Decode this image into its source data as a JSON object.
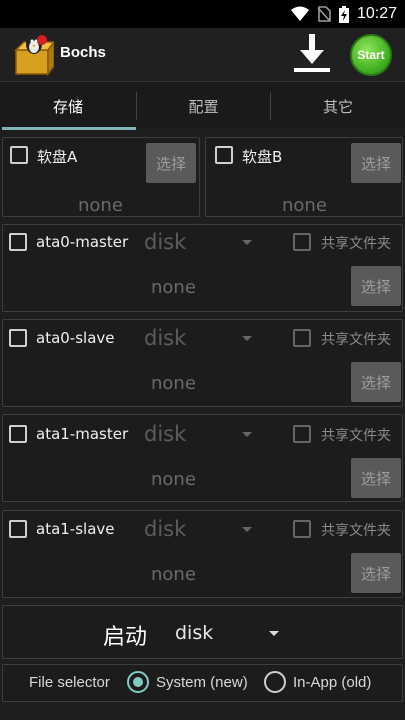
{
  "status_bar": {
    "time": "10:27",
    "icons": [
      "wifi-icon",
      "no-sim-icon",
      "battery-charging-icon"
    ]
  },
  "app_bar": {
    "title": "Bochs",
    "start_label": "Start",
    "download_icon": "download-icon",
    "logo_icon": "bochs-logo-icon"
  },
  "tabs": [
    {
      "label": "存储"
    },
    {
      "label": "配置"
    },
    {
      "label": "其它"
    }
  ],
  "floppy": [
    {
      "label": "软盘A",
      "choose": "选择",
      "value": "none"
    },
    {
      "label": "软盘B",
      "choose": "选择",
      "value": "none"
    }
  ],
  "ata": [
    {
      "label": "ata0-master",
      "type": "disk",
      "shared": "共享文件夹",
      "value": "none",
      "choose": "选择"
    },
    {
      "label": "ata0-slave",
      "type": "disk",
      "shared": "共享文件夹",
      "value": "none",
      "choose": "选择"
    },
    {
      "label": "ata1-master",
      "type": "disk",
      "shared": "共享文件夹",
      "value": "none",
      "choose": "选择"
    },
    {
      "label": "ata1-slave",
      "type": "disk",
      "shared": "共享文件夹",
      "value": "none",
      "choose": "选择"
    }
  ],
  "boot": {
    "label": "启动",
    "value": "disk"
  },
  "file_selector": {
    "label": "File selector",
    "options": [
      {
        "label": "System (new)",
        "selected": true
      },
      {
        "label": "In-App (old)",
        "selected": false
      }
    ]
  },
  "colors": {
    "accent": "#80cbc4",
    "start_green": "#3fae1f",
    "background": "#1e1e1e"
  }
}
